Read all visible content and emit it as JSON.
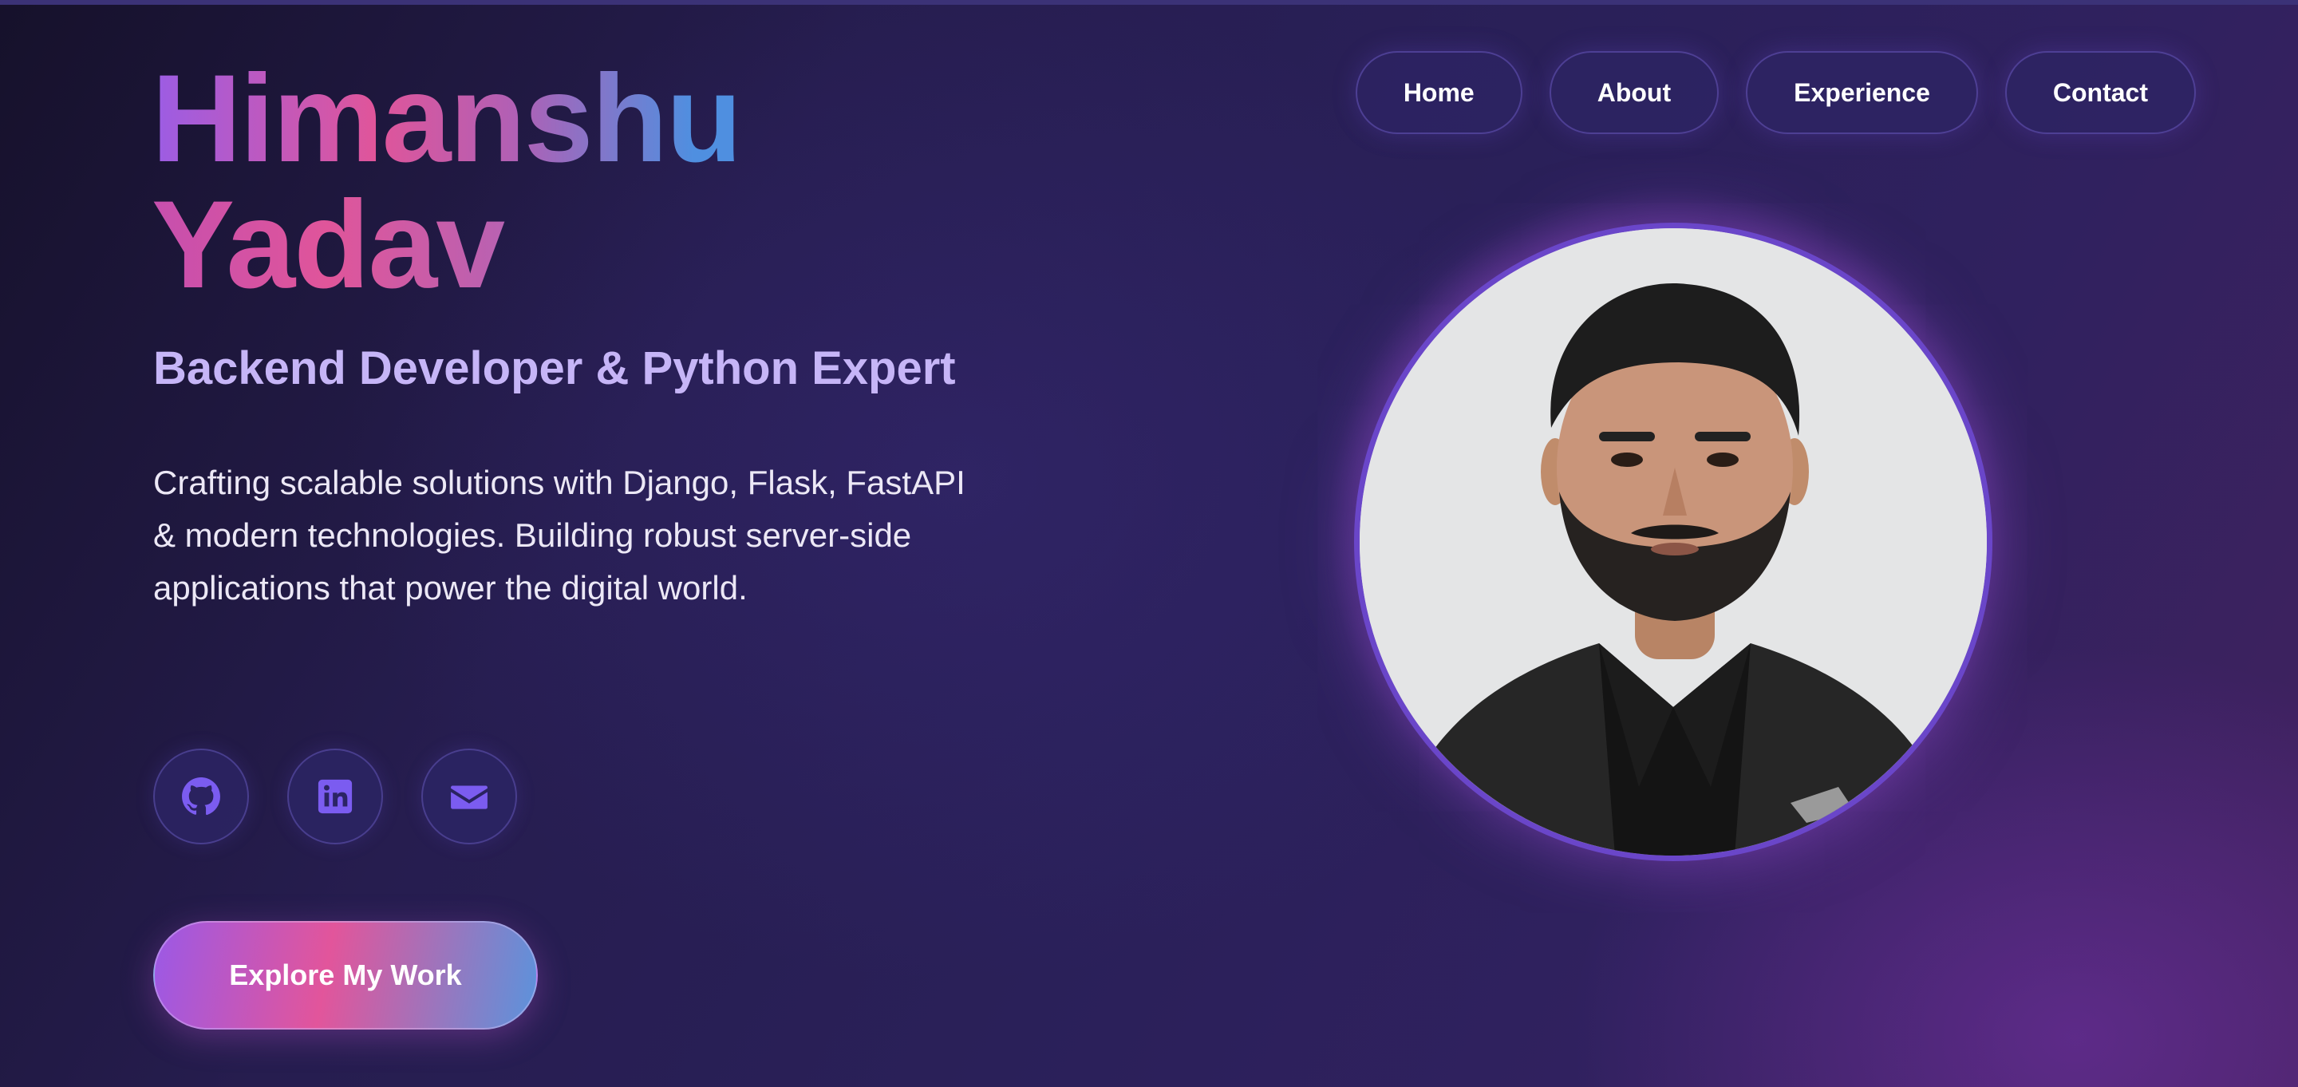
{
  "nav": {
    "items": [
      {
        "label": "Home"
      },
      {
        "label": "About"
      },
      {
        "label": "Experience"
      },
      {
        "label": "Contact"
      }
    ]
  },
  "hero": {
    "name_line1": "Himanshu",
    "name_line2": "Yadav",
    "subtitle": "Backend Developer & Python Expert",
    "description": "Crafting scalable solutions with Django, Flask, FastAPI & modern technologies. Building robust server-side applications that power the digital world.",
    "cta_label": "Explore My Work"
  },
  "socials": [
    {
      "icon": "github-icon"
    },
    {
      "icon": "linkedin-icon"
    },
    {
      "icon": "mail-icon"
    }
  ],
  "colors": {
    "accent_purple": "#9b5de5",
    "accent_pink": "#e0559a",
    "accent_blue": "#4f8fe0",
    "subtitle": "#c6b5f7",
    "icon": "#7b5cf0"
  }
}
